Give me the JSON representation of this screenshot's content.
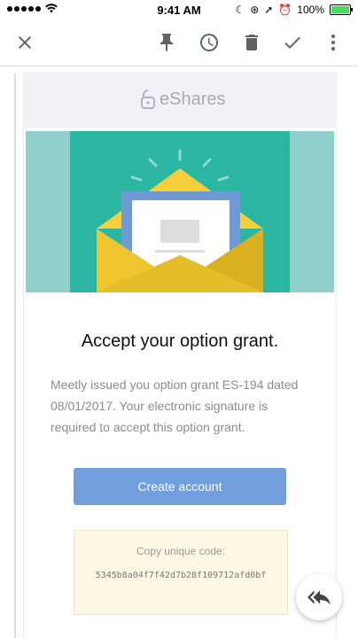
{
  "status_bar": {
    "time": "9:41 AM",
    "battery": "100%"
  },
  "toolbar": {
    "icons": [
      "close-icon",
      "pin-icon",
      "snooze-clock-icon",
      "trash-icon",
      "done-check-icon",
      "more-vert-icon"
    ]
  },
  "email": {
    "brand": "eShares",
    "title": "Accept your option grant.",
    "description": "Meetly issued you option grant ES-194 dated 08/01/2017. Your electronic signature is required to accept this option grant.",
    "cta_label": "Create account",
    "code_label": "Copy unique code:",
    "code_value": "5345b8a04f7f42d7b28f109712afd0bf"
  },
  "colors": {
    "accent": "#739ede",
    "hero_teal": "#2bb5a3",
    "hero_side": "#8fd0cc",
    "envelope_yellow": "#f5cf3a",
    "code_bg": "#fdf8e4"
  }
}
